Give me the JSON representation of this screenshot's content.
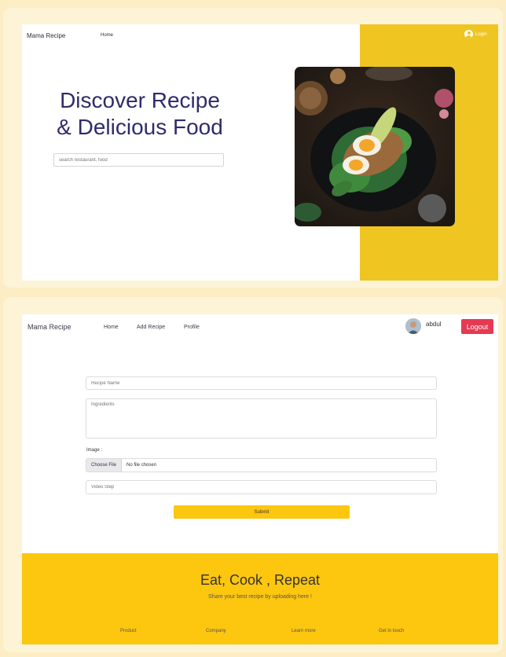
{
  "landing": {
    "brand": "Mama Recipe",
    "nav_home": "Home",
    "login_label": "Login",
    "hero_line1": "Discover Recipe",
    "hero_line2": "& Delicious Food",
    "search_placeholder": "search restaurant, food",
    "accent_color": "#efc522"
  },
  "add_recipe": {
    "brand": "Mama Recipe",
    "nav": [
      "Home",
      "Add Recipe",
      "Profile"
    ],
    "username": "abdul",
    "logout_label": "Logout",
    "recipe_name_placeholder": "Recipe Name",
    "ingredients_placeholder": "Ingredients",
    "image_label": "Image :",
    "choose_file_label": "Choose File",
    "no_file_text": "No file chosen",
    "video_step_placeholder": "Video Step",
    "submit_label": "Submit",
    "footer": {
      "heading": "Eat, Cook , Repeat",
      "subheading": "Share your best recipe by uploading here !",
      "links": [
        "Product",
        "Company",
        "Learn more",
        "Get in touch"
      ]
    },
    "logout_color": "#e53a52",
    "footer_color": "#fdc60f"
  }
}
